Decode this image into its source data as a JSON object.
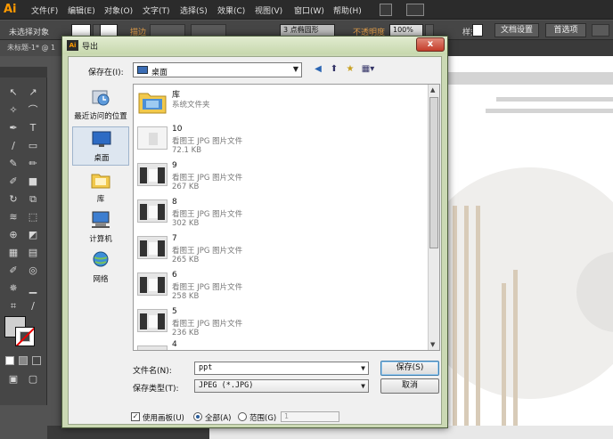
{
  "app": {
    "logo": "Ai",
    "accent": "#ff9a00"
  },
  "menubar": {
    "items": [
      "文件(F)",
      "编辑(E)",
      "对象(O)",
      "文字(T)",
      "选择(S)",
      "效果(C)",
      "视图(V)",
      "窗口(W)",
      "帮助(H)"
    ]
  },
  "controlbar": {
    "no_selection": "未选择对象",
    "stroke_label": "描边",
    "brush_value": "3 点椭圆形",
    "opacity_label": "不透明度",
    "opacity_value": "100%",
    "style_label": "样式:",
    "doc_setup": "文档设置",
    "preferences": "首选项"
  },
  "document_tab": {
    "title": "未标题-1* @ 1"
  },
  "dialog": {
    "title": "导出",
    "close": "x",
    "save_in_label": "保存在(I):",
    "save_in_value": "桌面",
    "places": [
      {
        "label": "最近访问的位置",
        "icon": "recent-icon"
      },
      {
        "label": "桌面",
        "icon": "desktop-icon"
      },
      {
        "label": "库",
        "icon": "library-icon"
      },
      {
        "label": "计算机",
        "icon": "computer-icon"
      },
      {
        "label": "网络",
        "icon": "network-icon"
      }
    ],
    "files": [
      {
        "name": "库",
        "type": "系统文件夹",
        "size": "",
        "icon": "folder-icon"
      },
      {
        "name": "10",
        "type": "看图王 JPG 图片文件",
        "size": "72.1 KB",
        "icon": "jpg-thumb-icon"
      },
      {
        "name": "9",
        "type": "看图王 JPG 图片文件",
        "size": "267 KB",
        "icon": "jpg-thumb-icon"
      },
      {
        "name": "8",
        "type": "看图王 JPG 图片文件",
        "size": "302 KB",
        "icon": "jpg-thumb-icon"
      },
      {
        "name": "7",
        "type": "看图王 JPG 图片文件",
        "size": "265 KB",
        "icon": "jpg-thumb-icon"
      },
      {
        "name": "6",
        "type": "看图王 JPG 图片文件",
        "size": "258 KB",
        "icon": "jpg-thumb-icon"
      },
      {
        "name": "5",
        "type": "看图王 JPG 图片文件",
        "size": "236 KB",
        "icon": "jpg-thumb-icon"
      },
      {
        "name": "4",
        "type": "",
        "size": "",
        "icon": "jpg-thumb-icon"
      }
    ],
    "filename_label": "文件名(N):",
    "filename_value": "ppt",
    "filetype_label": "保存类型(T):",
    "filetype_value": "JPEG (*.JPG)",
    "save_button": "保存(S)",
    "cancel_button": "取消",
    "use_artboard_label": "使用画板(U)",
    "all_label": "全部(A)",
    "range_label": "范围(G)",
    "range_value": "1"
  }
}
